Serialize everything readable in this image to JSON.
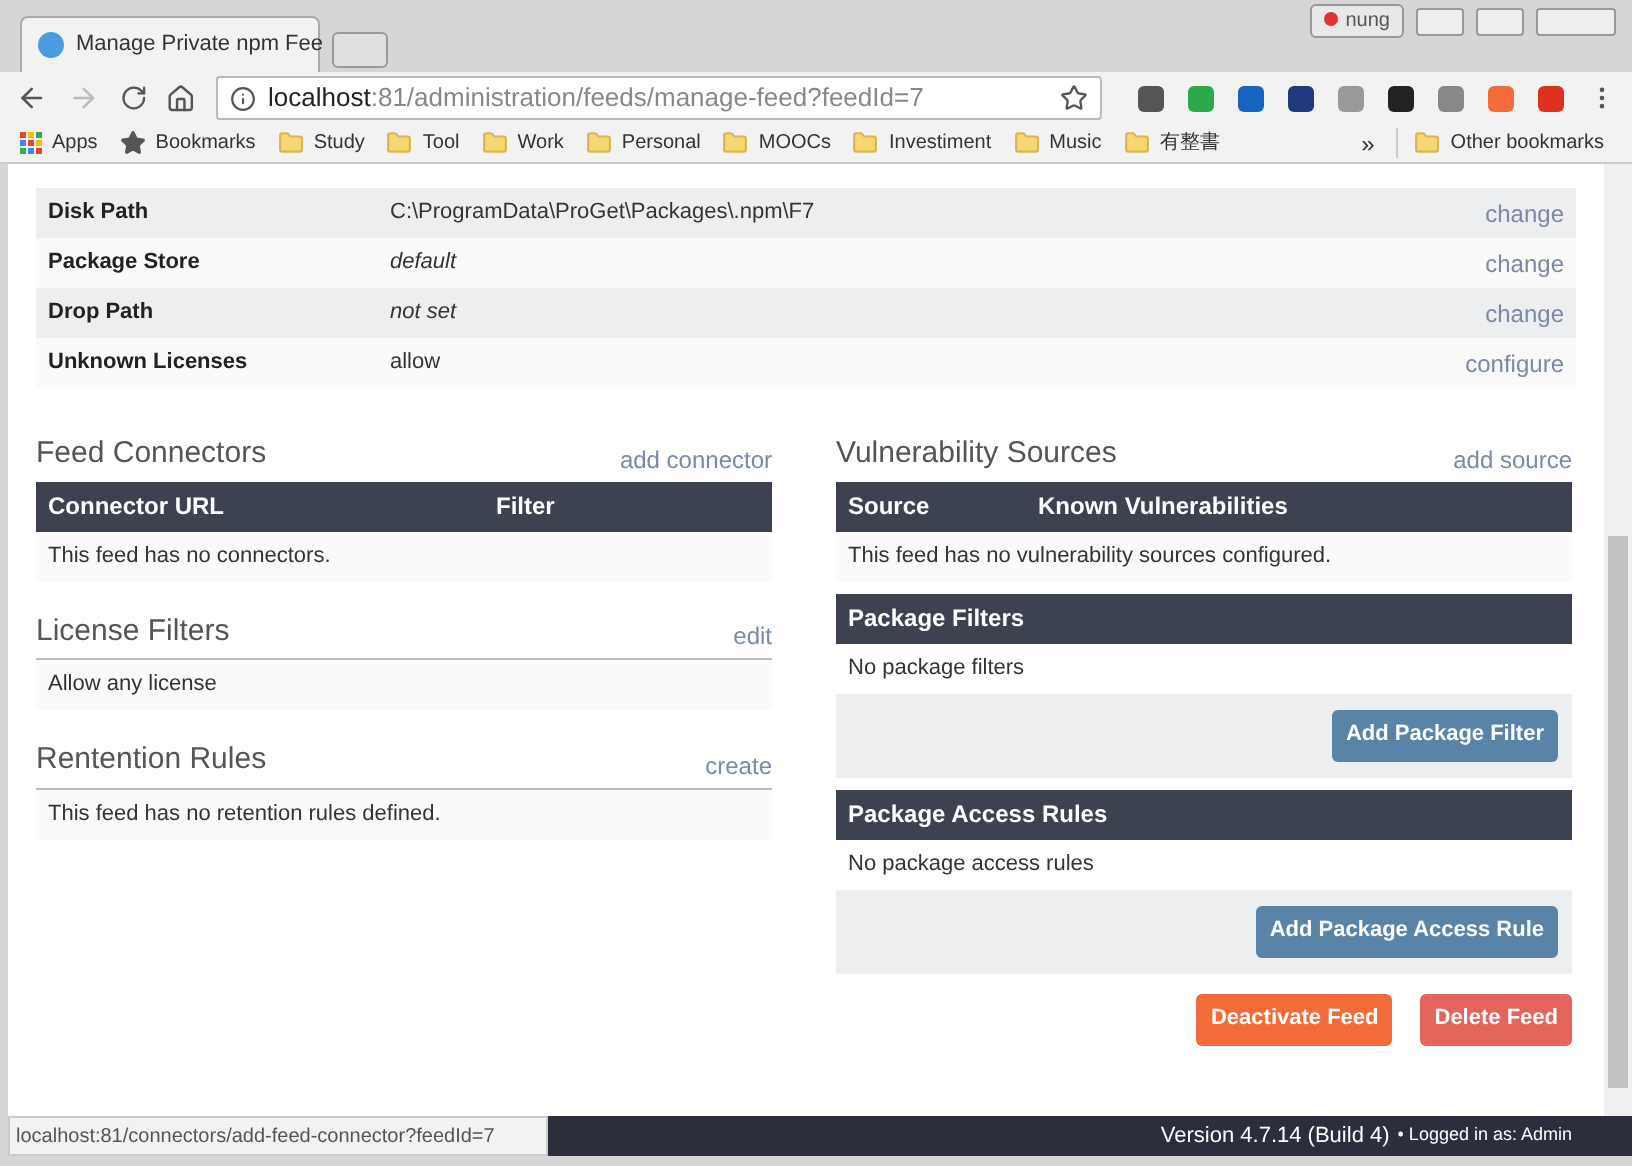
{
  "browser": {
    "profile": "nung",
    "tab_title": "Manage Private npm Fee",
    "url_host": "localhost",
    "url_rest": ":81/administration/feeds/manage-feed?feedId=7",
    "bookmarks": [
      {
        "label": "Apps",
        "kind": "apps"
      },
      {
        "label": "Bookmarks",
        "kind": "star"
      },
      {
        "label": "Study",
        "kind": "folder"
      },
      {
        "label": "Tool",
        "kind": "folder"
      },
      {
        "label": "Work",
        "kind": "folder"
      },
      {
        "label": "Personal",
        "kind": "folder"
      },
      {
        "label": "MOOCs",
        "kind": "folder"
      },
      {
        "label": "Investiment",
        "kind": "folder"
      },
      {
        "label": "Music",
        "kind": "folder"
      },
      {
        "label": "有整書",
        "kind": "folder"
      }
    ],
    "overflow": "»",
    "other_bookmarks": "Other bookmarks"
  },
  "settings": [
    {
      "label": "Disk Path",
      "value": "C:\\ProgramData\\ProGet\\Packages\\.npm\\F7",
      "italic": false,
      "action": "change"
    },
    {
      "label": "Package Store",
      "value": "default",
      "italic": true,
      "action": "change"
    },
    {
      "label": "Drop Path",
      "value": "not set",
      "italic": true,
      "action": "change"
    },
    {
      "label": "Unknown Licenses",
      "value": "allow",
      "italic": false,
      "action": "configure"
    }
  ],
  "feed_connectors": {
    "title": "Feed Connectors",
    "action": "add connector",
    "columns": [
      "Connector URL",
      "Filter"
    ],
    "empty": "This feed has no connectors."
  },
  "license_filters": {
    "title": "License Filters",
    "action": "edit",
    "text": "Allow any license"
  },
  "retention_rules": {
    "title": "Rentention Rules",
    "action": "create",
    "text": "This feed has no retention rules defined."
  },
  "vulnerability_sources": {
    "title": "Vulnerability Sources",
    "action": "add source",
    "columns": [
      "Source",
      "Known Vulnerabilities"
    ],
    "empty": "This feed has no vulnerability sources configured."
  },
  "package_filters": {
    "title": "Package Filters",
    "text": "No package filters",
    "button": "Add Package Filter"
  },
  "package_access_rules": {
    "title": "Package Access Rules",
    "text": "No package access rules",
    "button": "Add Package Access Rule"
  },
  "actions": [
    {
      "label": "Deactivate Feed",
      "color": "#f26b38"
    },
    {
      "label": "Delete Feed",
      "color": "#e3655b"
    }
  ],
  "footer": {
    "version": "Version 4.7.14 (Build 4)",
    "logged_in": "• Logged in as: Admin"
  },
  "status_url": "localhost:81/connectors/add-feed-connector?feedId=7"
}
